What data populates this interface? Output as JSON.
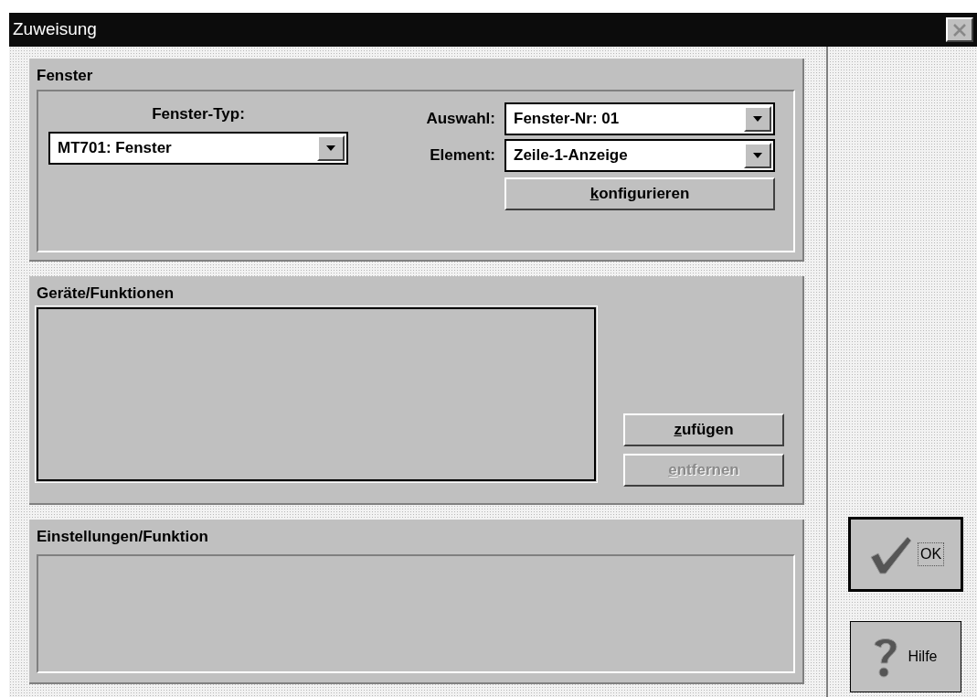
{
  "window": {
    "title": "Zuweisung"
  },
  "fenster": {
    "title": "Fenster",
    "type_label": "Fenster-Typ:",
    "type_value": "MT701: Fenster",
    "fields": [
      {
        "label": "Auswahl:",
        "value": "Fenster-Nr: 01"
      },
      {
        "label": "Element:",
        "value": "Zeile-1-Anzeige"
      }
    ],
    "button": {
      "label": "konfigurieren",
      "mnemonic": true,
      "disabled": false
    }
  },
  "geraete": {
    "title": "Geräte/Funktionen",
    "buttons": [
      {
        "label": "zufügen",
        "mnemonic": true,
        "disabled": false
      },
      {
        "label": "entfernen",
        "mnemonic": true,
        "disabled": true
      }
    ]
  },
  "einstellungen": {
    "title": "Einstellungen/Funktion"
  },
  "side_buttons": [
    {
      "kind": "ok",
      "label": "OK",
      "default": true,
      "focused": true
    },
    {
      "kind": "help",
      "label": "Hilfe",
      "default": false,
      "focused": false
    }
  ]
}
